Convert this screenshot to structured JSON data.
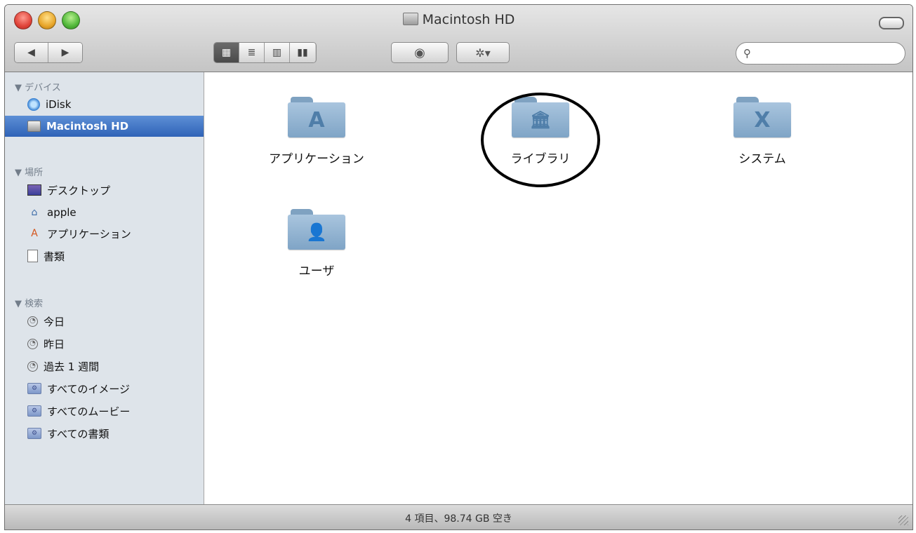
{
  "window": {
    "title": "Macintosh HD"
  },
  "toolbar": {
    "nav_back_icon": "◀",
    "nav_forward_icon": "▶",
    "view_icons": [
      "▦",
      "≣",
      "▥",
      "▮▮"
    ],
    "quicklook_icon": "◉",
    "action_icon": "✲▾",
    "search": {
      "icon": "⚲",
      "value": "",
      "placeholder": ""
    }
  },
  "sidebar": {
    "sections": [
      {
        "header": "▼ デバイス",
        "items": [
          {
            "label": "iDisk",
            "icon": "idisk-icon"
          },
          {
            "label": "Macintosh HD",
            "icon": "hard-drive-icon",
            "selected": true
          }
        ]
      },
      {
        "header": "▼ 場所",
        "items": [
          {
            "label": "デスクトップ",
            "icon": "desktop-icon"
          },
          {
            "label": "apple",
            "icon": "home-icon"
          },
          {
            "label": "アプリケーション",
            "icon": "applications-icon"
          },
          {
            "label": "書類",
            "icon": "document-icon"
          }
        ]
      },
      {
        "header": "▼ 検索",
        "items": [
          {
            "label": "今日",
            "icon": "clock-icon"
          },
          {
            "label": "昨日",
            "icon": "clock-icon"
          },
          {
            "label": "過去 1 週間",
            "icon": "clock-icon"
          },
          {
            "label": "すべてのイメージ",
            "icon": "smart-folder-icon"
          },
          {
            "label": "すべてのムービー",
            "icon": "smart-folder-icon"
          },
          {
            "label": "すべての書類",
            "icon": "smart-folder-icon"
          }
        ]
      }
    ]
  },
  "main": {
    "items": [
      {
        "label": "アプリケーション",
        "glyph": "A"
      },
      {
        "label": "ライブラリ",
        "glyph": "🏛"
      },
      {
        "label": "システム",
        "glyph": "X"
      },
      {
        "label": "ユーザ",
        "glyph": "👤"
      }
    ]
  },
  "statusbar": {
    "text": "4 項目、98.74 GB 空き"
  },
  "colors": {
    "selection": "#3d74c7",
    "sidebar_bg": "#dee4ea",
    "folder_blue": "#8fb1d1"
  }
}
